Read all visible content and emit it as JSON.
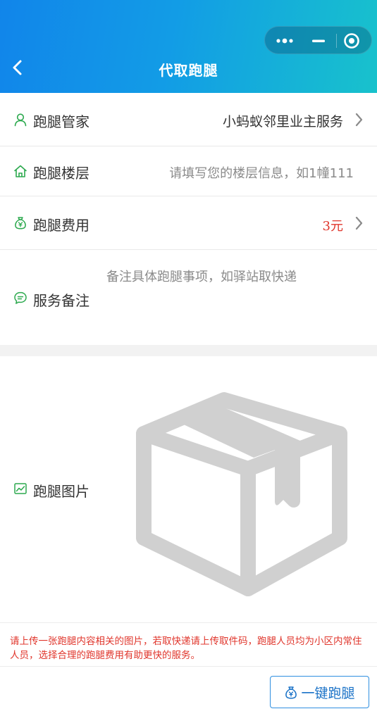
{
  "nav": {
    "title": "代取跑腿",
    "back_icon": "chevron-left-icon",
    "capsule_icons": [
      "more-dots-icon",
      "minimize-icon",
      "target-icon"
    ]
  },
  "form": {
    "manager": {
      "label": "跑腿管家",
      "value": "小蚂蚁邻里业主服务",
      "icon": "person-icon"
    },
    "floor": {
      "label": "跑腿楼层",
      "placeholder": "请填写您的楼层信息，如1幢111",
      "icon": "home-icon"
    },
    "fee": {
      "label": "跑腿费用",
      "value": "3元",
      "icon": "money-bag-icon"
    },
    "remark": {
      "label": "服务备注",
      "placeholder": "备注具体跑腿事项，如驿站取快递",
      "icon": "chat-bubble-icon"
    },
    "photo": {
      "label": "跑腿图片",
      "icon": "chart-icon",
      "graphic": "package-box-icon"
    }
  },
  "notice": "请上传一张跑腿内容相关的图片，若取快递请上传取件码，跑腿人员均为小区内常住人员，选择合理的跑腿费用有助更快的服务。",
  "action": {
    "label": "一键跑腿",
    "icon": "money-bag-icon"
  },
  "colors": {
    "header_start": "#1185ea",
    "header_end": "#18c2cc",
    "icon_green": "#2ca94e",
    "accent_red": "#e0362c",
    "button_blue": "#1a72c7"
  }
}
